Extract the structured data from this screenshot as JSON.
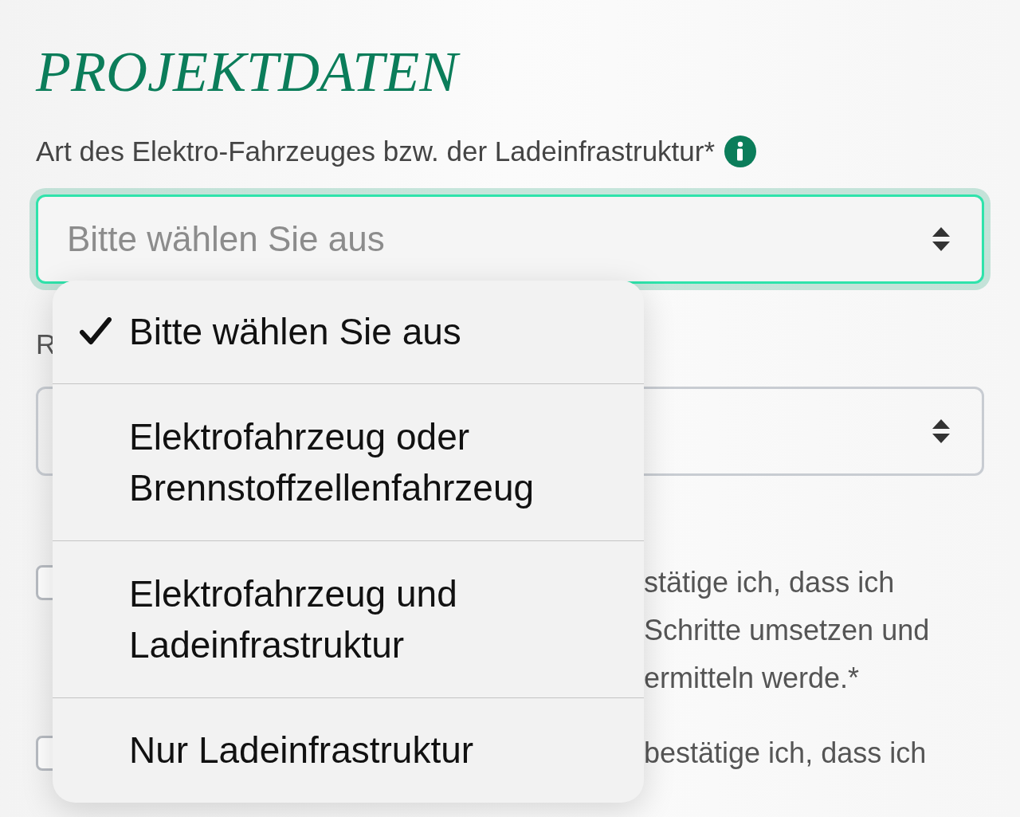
{
  "heading": "PROJEKTDATEN",
  "vehicle_type": {
    "label": "Art des Elektro-Fahrzeuges bzw. der Ladeinfrastruktur*",
    "placeholder": "Bitte wählen Sie aus",
    "focused": true
  },
  "second_field": {
    "label": "R"
  },
  "confirmations": [
    {
      "checked": false,
      "lines": [
        {
          "text": "stätige ich, dass ich",
          "partly_hidden": true
        },
        {
          "text": "Schritte umsetzen und",
          "partly_hidden": true
        },
        {
          "text": "ermitteln werde.*",
          "partly_hidden": true
        }
      ]
    },
    {
      "checked": false,
      "lines": [
        {
          "text": "bestätige ich, dass ich",
          "partly_hidden": true
        }
      ]
    }
  ],
  "dropdown": {
    "options": [
      {
        "label": "Bitte wählen Sie aus",
        "selected": true
      },
      {
        "label": "Elektrofahrzeug oder Brennstoffzellenfahrzeug",
        "selected": false
      },
      {
        "label": "Elektrofahrzeug und Ladeinfrastruktur",
        "selected": false
      },
      {
        "label": "Nur Ladeinfrastruktur",
        "selected": false
      }
    ]
  }
}
